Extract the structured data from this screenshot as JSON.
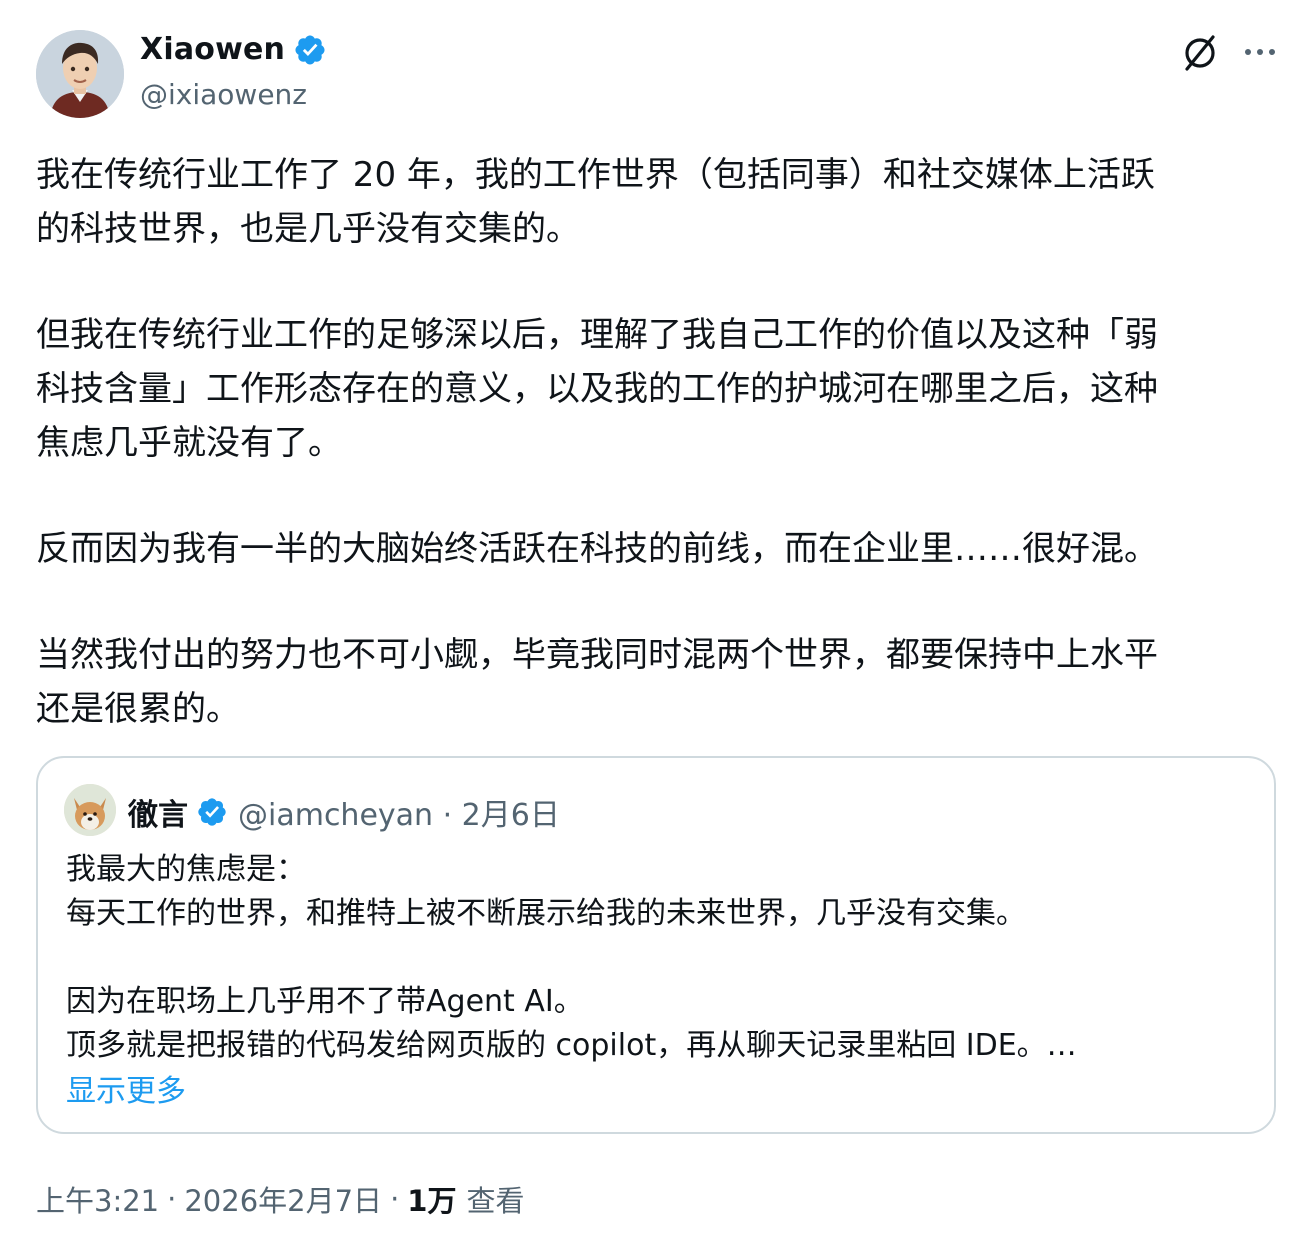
{
  "author": {
    "name": "Xiaowen",
    "handle": "@ixiaowenz",
    "verified_color": "#1d9bf0",
    "avatar": "cartoon-man-avatar"
  },
  "actions": {
    "grok_icon": "slashed-circle-icon",
    "more_icon": "more-dots-icon"
  },
  "tweet": {
    "paragraphs": [
      "我在传统行业工作了 20 年，我的工作世界（包括同事）和社交媒体上活跃\n的科技世界，也是几乎没有交集的。",
      "但我在传统行业工作的足够深以后，理解了我自己工作的价值以及这种「弱\n科技含量」工作形态存在的意义，以及我的工作的护城河在哪里之后，这种\n焦虑几乎就没有了。",
      "反而因为我有一半的大脑始终活跃在科技的前线，而在企业里……很好混。",
      "当然我付出的努力也不可小觑，毕竟我同时混两个世界，都要保持中上水平\n还是很累的。"
    ]
  },
  "quote": {
    "name": "徹言",
    "handle": "@iamcheyan",
    "date": "2月6日",
    "meta": "@iamcheyan · 2月6日",
    "avatar": "dog-avatar",
    "text": "我最大的焦虑是：\n每天工作的世界，和推特上被不断展示给我的未来世界，几乎没有交集。\n\n因为在职场上几乎用不了带Agent AI。\n顶多就是把报错的代码发给网页版的 copilot，再从聊天记录里粘回 IDE。…",
    "show_more": "显示更多"
  },
  "footer": {
    "time": "上午3:21",
    "date": "2026年2月7日",
    "views_count": "1万",
    "views_label": "查看",
    "separator": "·"
  },
  "colors": {
    "text": "#0f1419",
    "secondary": "#536471",
    "accent": "#1d9bf0",
    "border": "#cfd9de"
  }
}
